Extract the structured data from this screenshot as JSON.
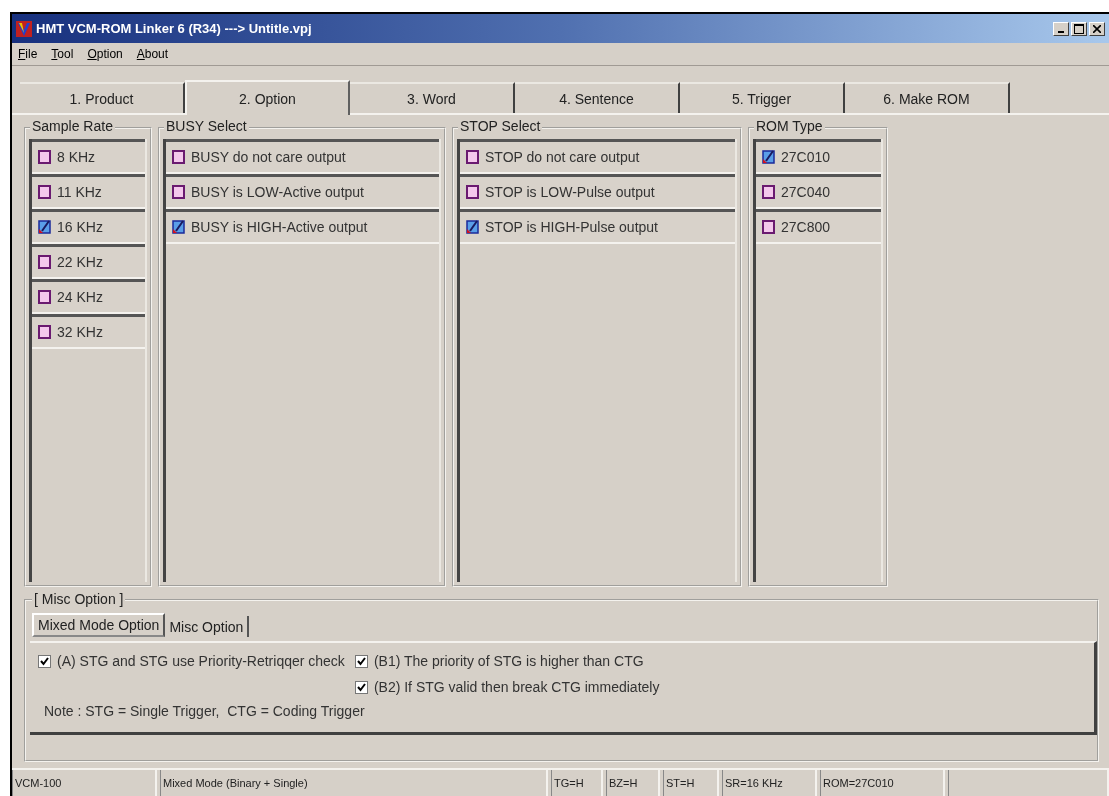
{
  "window": {
    "title": "HMT VCM-ROM Linker 6 (R34) ---> Untitle.vpj"
  },
  "menu": [
    "File",
    "Tool",
    "Option",
    "About"
  ],
  "tabs": [
    {
      "label": "1. Product",
      "selected": false
    },
    {
      "label": "2. Option",
      "selected": true
    },
    {
      "label": "3. Word",
      "selected": false
    },
    {
      "label": "4. Sentence",
      "selected": false
    },
    {
      "label": "5. Trigger",
      "selected": false
    },
    {
      "label": "6. Make ROM",
      "selected": false
    }
  ],
  "groups": [
    {
      "title": "Sample Rate",
      "items": [
        {
          "label": "8 KHz",
          "checked": false
        },
        {
          "label": "11 KHz",
          "checked": false
        },
        {
          "label": "16 KHz",
          "checked": true
        },
        {
          "label": "22 KHz",
          "checked": false
        },
        {
          "label": "24 KHz",
          "checked": false
        },
        {
          "label": "32 KHz",
          "checked": false
        }
      ]
    },
    {
      "title": "BUSY Select",
      "items": [
        {
          "label": "BUSY do not care output",
          "checked": false
        },
        {
          "label": "BUSY is LOW-Active output",
          "checked": false
        },
        {
          "label": "BUSY is HIGH-Active output",
          "checked": true
        }
      ]
    },
    {
      "title": "STOP Select",
      "items": [
        {
          "label": "STOP do not care output",
          "checked": false
        },
        {
          "label": "STOP is LOW-Pulse output",
          "checked": false
        },
        {
          "label": "STOP is HIGH-Pulse output",
          "checked": true
        }
      ]
    },
    {
      "title": "ROM Type",
      "items": [
        {
          "label": "27C010",
          "checked": true
        },
        {
          "label": "27C040",
          "checked": false
        },
        {
          "label": "27C800",
          "checked": false
        }
      ]
    }
  ],
  "misc": {
    "title": "[ Misc Option ]",
    "tabs": [
      {
        "label": "Mixed Mode Option",
        "selected": true
      },
      {
        "label": "Misc Option",
        "selected": false
      }
    ],
    "option_a": {
      "label": "(A) STG and STG use Priority-Retriqqer check",
      "checked": true
    },
    "options_b": [
      {
        "label": "(B1) The priority of STG is higher than CTG",
        "checked": true
      },
      {
        "label": "(B2) If STG valid then break CTG immediately",
        "checked": true
      }
    ],
    "note": "Note : STG = Single Trigger,  CTG = Coding Trigger"
  },
  "status_bar": [
    "VCM-100",
    "Mixed Mode (Binary + Single)",
    "TG=H",
    "BZ=H",
    "ST=H",
    "SR=16 KHz",
    "ROM=27C010"
  ]
}
